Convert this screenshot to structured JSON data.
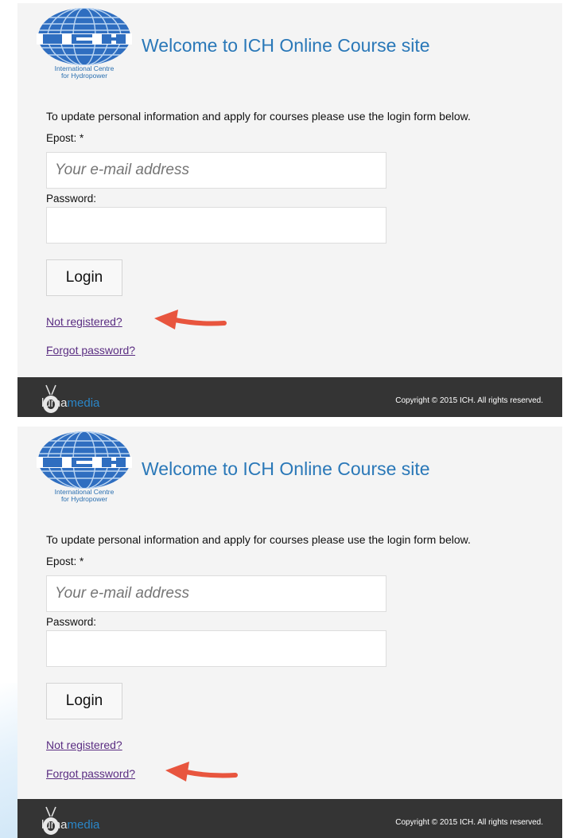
{
  "logo": {
    "letters": "ICH",
    "tagline_line1": "International Centre",
    "tagline_line2": "for Hydropower"
  },
  "page": {
    "title": "Welcome to ICH Online Course site",
    "intro": "To update personal information and apply for courses please use the login form below."
  },
  "form": {
    "email_label": "Epost: *",
    "email_placeholder": "Your e-mail address",
    "password_label": "Password:",
    "login_label": "Login",
    "not_registered_link": "Not registered?",
    "forgot_password_link": "Forgot password?"
  },
  "footer": {
    "brand_part1": "luma",
    "brand_part2": "media",
    "copyright": "Copyright © 2015 ICH. All rights reserved."
  },
  "colors": {
    "title_blue": "#2a78b8",
    "link_purple": "#5a2d82",
    "arrow_red": "#e8553e",
    "footer_bg": "#343434",
    "panel_bg": "#f4f4f4"
  },
  "annotations": {
    "panel1_arrow_target": "not-registered-link",
    "panel2_arrow_target": "forgot-password-link"
  }
}
